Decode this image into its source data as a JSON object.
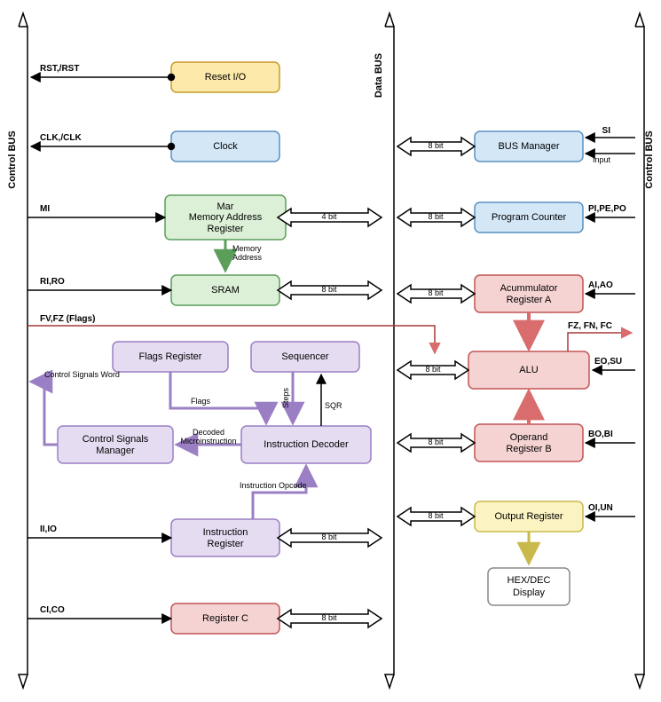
{
  "buses": {
    "control_left": "Control BUS",
    "data": "Data BUS",
    "control_right": "Control BUS"
  },
  "blocks": {
    "reset": "Reset I/O",
    "clock": "Clock",
    "mar1": "Mar",
    "mar2": "Memory Address",
    "mar3": "Register",
    "sram": "SRAM",
    "flags": "Flags Register",
    "seq": "Sequencer",
    "csm1": "Control Signals",
    "csm2": "Manager",
    "idec": "Instruction Decoder",
    "ireg1": "Instruction",
    "ireg2": "Register",
    "regc": "Register C",
    "busman": "BUS Manager",
    "pc": "Program Counter",
    "acc1": "Acummulator",
    "acc2": "Register A",
    "alu": "ALU",
    "opb1": "Operand",
    "opb2": "Register B",
    "out": "Output Register",
    "hex1": "HEX/DEC",
    "hex2": "Display"
  },
  "widths": {
    "w4": "4 bit",
    "w8": "8 bit"
  },
  "signals": {
    "rst": "RST,/RST",
    "clk": "CLK,/CLK",
    "mi": "MI",
    "ri": "RI,RO",
    "fv": "FV,FZ (Flags)",
    "csw": "Control Signals Word",
    "ii": "II,IO",
    "ci": "CI,CO",
    "si": "SI",
    "input": "Input",
    "pi": "PI,PE,PO",
    "ai": "AI,AO",
    "fz": "FZ, FN, FC",
    "eo": "EO,SU",
    "bo": "BO,BI",
    "oi": "OI,UN"
  },
  "edges": {
    "memaddr": "Memory",
    "memaddr2": "Address",
    "flags": "Flags",
    "steps": "Steps",
    "sqr": "SQR",
    "decoded1": "Decoded",
    "decoded2": "Microinstruction",
    "opcode": "Instruction Opcode"
  }
}
